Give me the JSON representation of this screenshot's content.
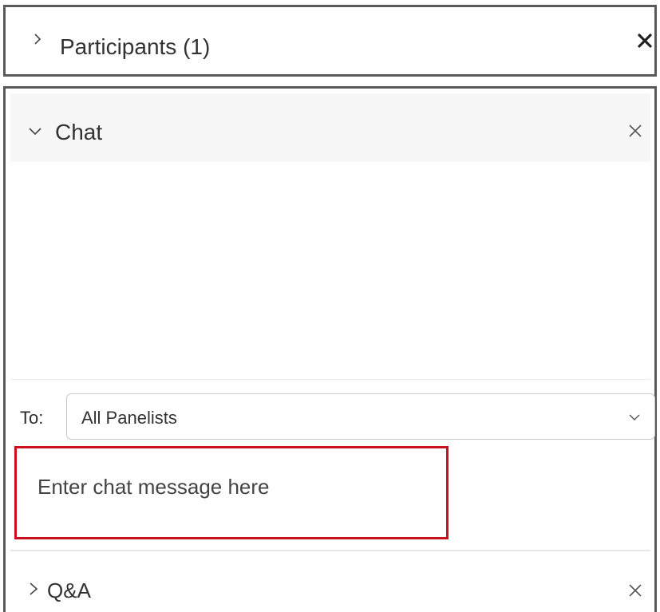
{
  "participants": {
    "title": "Participants (1)",
    "expand_icon": "chevron-right-icon",
    "close_icon": "close-icon"
  },
  "chat": {
    "title": "Chat",
    "collapse_icon": "chevron-down-icon",
    "close_icon": "close-icon",
    "to_label": "To:",
    "recipient_value": "All Panelists",
    "recipient_dropdown_icon": "chevron-down-icon",
    "message_placeholder": "Enter chat message here",
    "highlight_color": "#c8101e"
  },
  "qa": {
    "title": "Q&A",
    "expand_icon": "chevron-right-icon",
    "close_icon": "close-icon"
  }
}
